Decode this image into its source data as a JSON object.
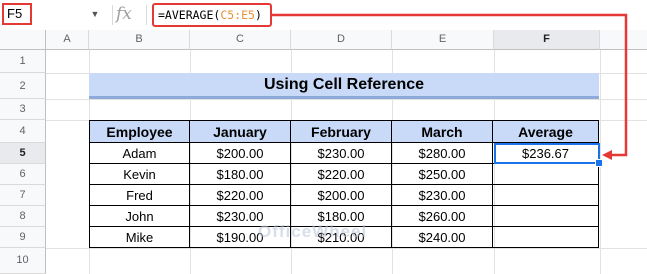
{
  "formula_bar": {
    "name_box": "F5",
    "fx_label": "fx",
    "formula_prefix": "=AVERAGE(",
    "formula_ref": "C5:E5",
    "formula_suffix": ")"
  },
  "columns": [
    "A",
    "B",
    "C",
    "D",
    "E",
    "F"
  ],
  "selected_column": "F",
  "rows": [
    "1",
    "2",
    "3",
    "4",
    "5",
    "6",
    "7",
    "8",
    "9",
    "10"
  ],
  "selected_row": "5",
  "title": "Using Cell Reference",
  "table": {
    "headers": [
      "Employee",
      "January",
      "February",
      "March",
      "Average"
    ],
    "rows": [
      [
        "Adam",
        "$200.00",
        "$230.00",
        "$280.00",
        "$236.67"
      ],
      [
        "Kevin",
        "$180.00",
        "$220.00",
        "$250.00",
        ""
      ],
      [
        "Fred",
        "$220.00",
        "$200.00",
        "$230.00",
        ""
      ],
      [
        "John",
        "$230.00",
        "$180.00",
        "$260.00",
        ""
      ],
      [
        "Mike",
        "$190.00",
        "$210.00",
        "$240.00",
        ""
      ]
    ]
  },
  "colors": {
    "highlight_red": "#e53935",
    "header_fill": "#c9daf8",
    "selection_blue": "#1a73e8",
    "formula_ref_orange": "#e69138"
  },
  "watermark": "OfficeWheel"
}
